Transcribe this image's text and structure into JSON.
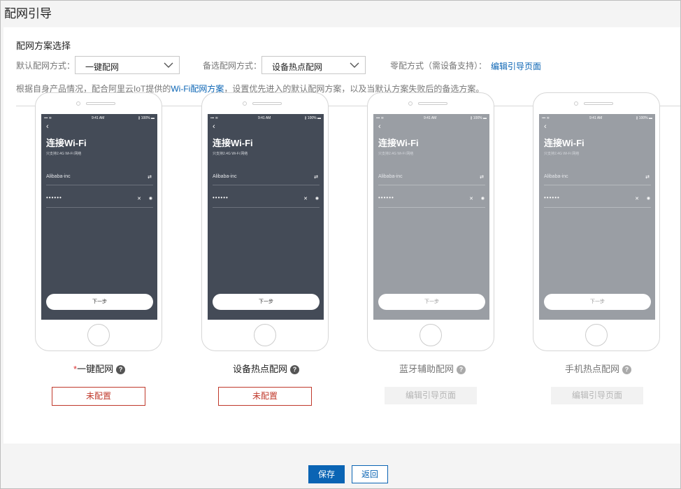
{
  "page": {
    "title": "配网引导"
  },
  "section": {
    "title": "配网方案选择",
    "default_label": "默认配网方式：",
    "default_value": "一键配网",
    "alt_label": "备选配网方式：",
    "alt_value": "设备热点配网",
    "zero_label": "零配方式（需设备支持）：",
    "zero_link": "编辑引导页面",
    "desc_prefix": "根据自身产品情况，配合阿里云IoT提供的",
    "desc_link": "Wi-Fi配网方案",
    "desc_suffix": "，设置优先进入的默认配网方案，以及当默认方案失败后的备选方案。"
  },
  "phone_screen": {
    "status_left": "▪▪▪ ≋",
    "status_center": "9:41 AM",
    "status_right": "∦ 100% ▬",
    "back": "‹",
    "title": "连接Wi-Fi",
    "subtitle": "只支持2.4G Wi-Fi 网络",
    "ssid": "Alibaba-inc",
    "ssid_icon": "⇄",
    "password": "••••••",
    "clear": "✕",
    "eye": "◉",
    "next": "下一步"
  },
  "cards": [
    {
      "required": "*",
      "caption": "一键配网",
      "help": "?",
      "button": "未配置"
    },
    {
      "caption": "设备热点配网",
      "help": "?",
      "button": "未配置"
    },
    {
      "caption": "蓝牙辅助配网",
      "help": "?",
      "button": "编辑引导页面"
    },
    {
      "caption": "手机热点配网",
      "help": "?",
      "button": "编辑引导页面"
    }
  ],
  "footer": {
    "save": "保存",
    "back": "返回"
  },
  "colors": {
    "primary": "#0a64b4",
    "danger": "#c0392b",
    "screen_dark": "#444b57",
    "screen_gray": "#9a9ea4"
  }
}
